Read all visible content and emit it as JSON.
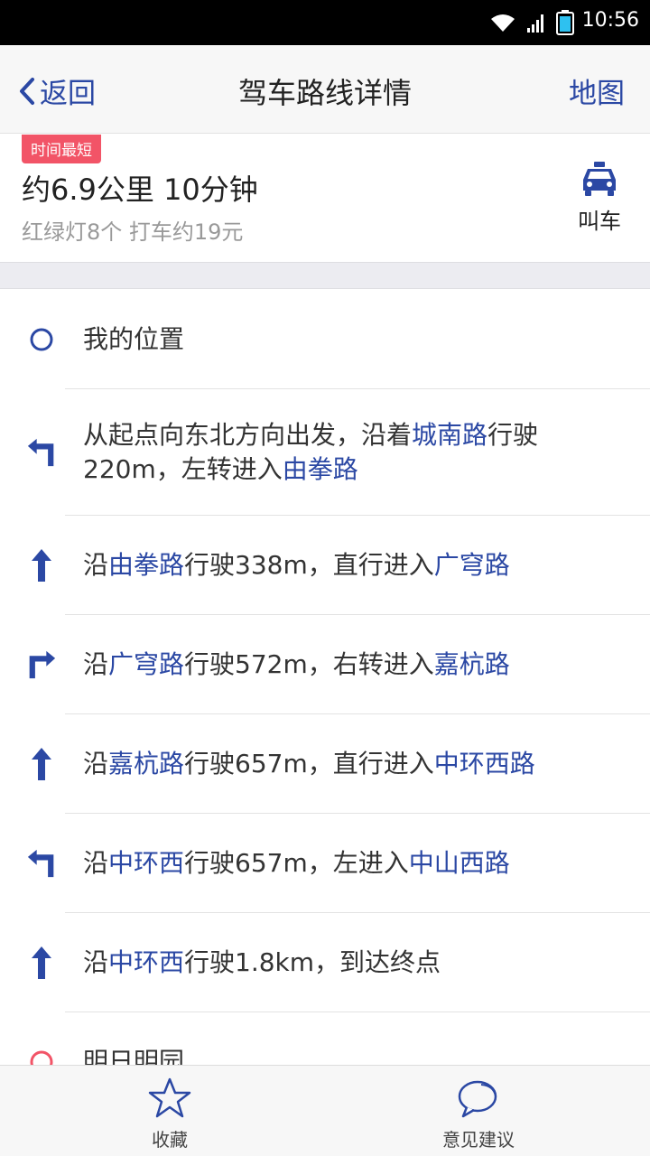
{
  "status_bar": {
    "time": "10:56"
  },
  "header": {
    "back_label": "返回",
    "title": "驾车路线详情",
    "map_label": "地图"
  },
  "summary": {
    "tag": "时间最短",
    "main": "约6.9公里 10分钟",
    "sub": "红绿灯8个  打车约19元",
    "taxi_label": "叫车"
  },
  "steps": [
    {
      "icon": "origin-circle-icon",
      "segments": [
        {
          "t": "我的位置",
          "road": false
        }
      ]
    },
    {
      "icon": "turn-left-icon",
      "segments": [
        {
          "t": "从起点向东北方向出发，沿着",
          "road": false
        },
        {
          "t": "城南路",
          "road": true
        },
        {
          "t": "行驶220m，左转进入",
          "road": false
        },
        {
          "t": "由拳路",
          "road": true
        }
      ]
    },
    {
      "icon": "straight-arrow-icon",
      "segments": [
        {
          "t": "沿",
          "road": false
        },
        {
          "t": "由拳路",
          "road": true
        },
        {
          "t": "行驶338m，直行进入",
          "road": false
        },
        {
          "t": "广穹路",
          "road": true
        }
      ]
    },
    {
      "icon": "turn-right-icon",
      "segments": [
        {
          "t": "沿",
          "road": false
        },
        {
          "t": "广穹路",
          "road": true
        },
        {
          "t": "行驶572m，右转进入",
          "road": false
        },
        {
          "t": "嘉杭路",
          "road": true
        }
      ]
    },
    {
      "icon": "straight-arrow-icon",
      "segments": [
        {
          "t": "沿",
          "road": false
        },
        {
          "t": "嘉杭路",
          "road": true
        },
        {
          "t": "行驶657m，直行进入",
          "road": false
        },
        {
          "t": "中环西路",
          "road": true
        }
      ]
    },
    {
      "icon": "turn-left-icon",
      "segments": [
        {
          "t": "沿",
          "road": false
        },
        {
          "t": "中环西",
          "road": true
        },
        {
          "t": "行驶657m，左进入",
          "road": false
        },
        {
          "t": "中山西路",
          "road": true
        }
      ]
    },
    {
      "icon": "straight-arrow-icon",
      "segments": [
        {
          "t": "沿",
          "road": false
        },
        {
          "t": "中环西",
          "road": true
        },
        {
          "t": "行驶1.8km，到达终点",
          "road": false
        }
      ]
    },
    {
      "icon": "destination-circle-icon",
      "segments": [
        {
          "t": "明日明园",
          "road": false
        }
      ]
    }
  ],
  "bottom_bar": {
    "favorite_label": "收藏",
    "feedback_label": "意见建议"
  },
  "colors": {
    "accent": "#2b48a4",
    "tag": "#f25467",
    "destination": "#f25467"
  }
}
